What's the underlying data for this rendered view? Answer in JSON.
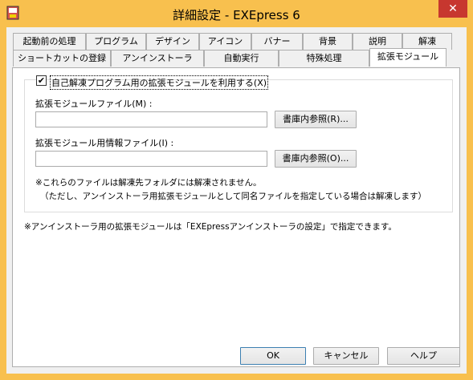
{
  "window": {
    "title": "詳細設定 - EXEpress 6",
    "close_glyph": "✕"
  },
  "tabs_row1": [
    "起動前の処理",
    "プログラム",
    "デザイン",
    "アイコン",
    "バナー",
    "背景",
    "説明",
    "解凍"
  ],
  "tabs_row2": [
    "ショートカットの登録",
    "アンインストーラ",
    "自動実行",
    "特殊処理",
    "拡張モジュール"
  ],
  "selected_tab": "拡張モジュール",
  "panel": {
    "use_module_checkbox": {
      "checked": true,
      "label": "自己解凍プログラム用の拡張モジュールを利用する(X)"
    },
    "module_file_label": "拡張モジュールファイル(M) :",
    "module_file_value": "",
    "module_browse_button": "書庫内参照(R)...",
    "module_info_label": "拡張モジュール用情報ファイル(I) :",
    "module_info_value": "",
    "module_info_browse_button": "書庫内参照(O)...",
    "note_line1": "※これらのファイルは解凍先フォルダには解凍されません。",
    "note_line2": "（ただし、アンインストーラ用拡張モジュールとして同名ファイルを指定している場合は解凍します）",
    "footer_note": "※アンインストーラ用の拡張モジュールは「EXEpressアンインストーラの設定」で指定できます。"
  },
  "buttons": {
    "ok": "OK",
    "cancel": "キャンセル",
    "help": "ヘルプ"
  },
  "colors": {
    "title_bar": "#f8c04e",
    "close_button": "#c7372f",
    "panel_bg": "#ffffff",
    "dialog_bg": "#f0f0f0"
  }
}
